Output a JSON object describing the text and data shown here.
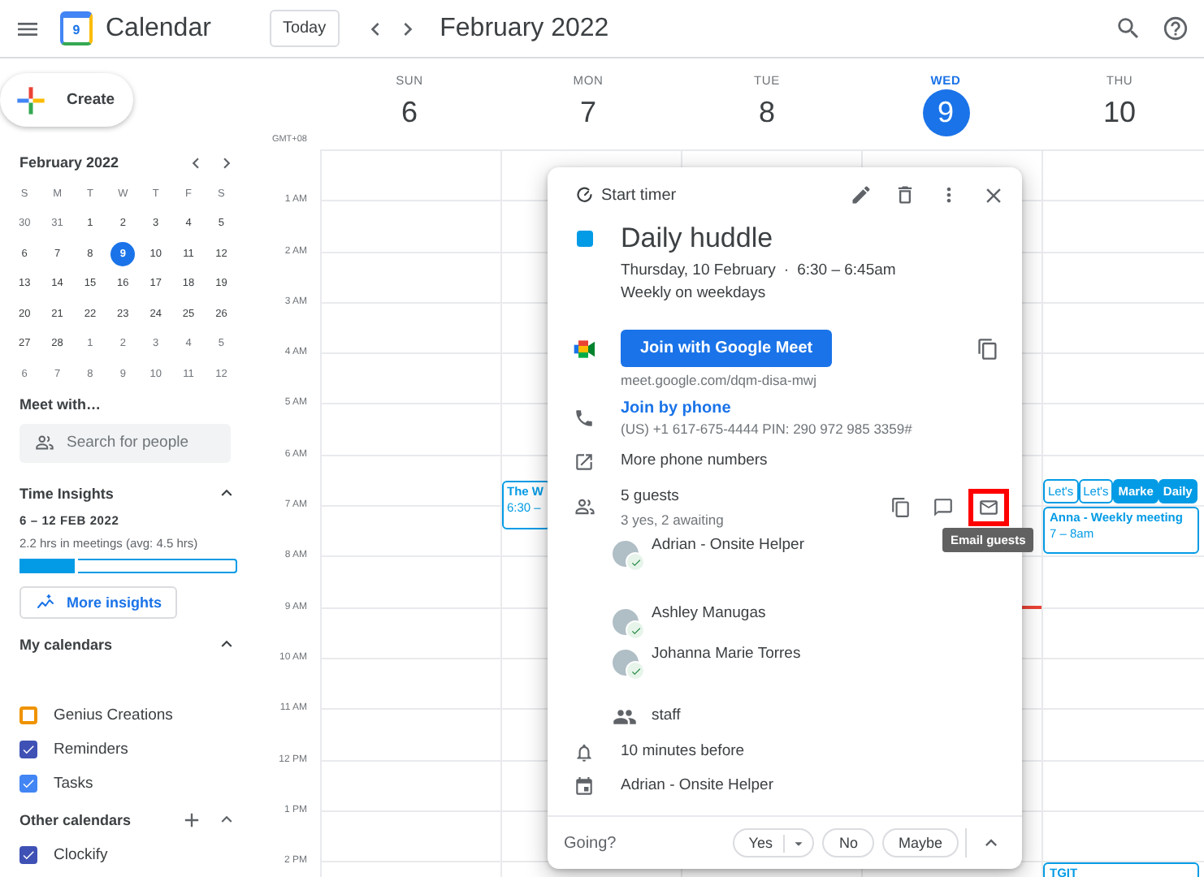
{
  "header": {
    "logo_day": "9",
    "app_name": "Calendar",
    "today_button": "Today",
    "period": "February 2022"
  },
  "sidebar": {
    "create_button": "Create",
    "mini_calendar": {
      "title": "February 2022",
      "weekdays": [
        "S",
        "M",
        "T",
        "W",
        "T",
        "F",
        "S"
      ],
      "weeks": [
        [
          {
            "day": "30",
            "outside": true,
            "selected": false
          },
          {
            "day": "31",
            "outside": true,
            "selected": false
          },
          {
            "day": "1",
            "outside": false,
            "selected": false
          },
          {
            "day": "2",
            "outside": false,
            "selected": false
          },
          {
            "day": "3",
            "outside": false,
            "selected": false
          },
          {
            "day": "4",
            "outside": false,
            "selected": false
          },
          {
            "day": "5",
            "outside": false,
            "selected": false
          }
        ],
        [
          {
            "day": "6",
            "outside": false,
            "selected": false
          },
          {
            "day": "7",
            "outside": false,
            "selected": false
          },
          {
            "day": "8",
            "outside": false,
            "selected": false
          },
          {
            "day": "9",
            "outside": false,
            "selected": true
          },
          {
            "day": "10",
            "outside": false,
            "selected": false
          },
          {
            "day": "11",
            "outside": false,
            "selected": false
          },
          {
            "day": "12",
            "outside": false,
            "selected": false
          }
        ],
        [
          {
            "day": "13",
            "outside": false,
            "selected": false
          },
          {
            "day": "14",
            "outside": false,
            "selected": false
          },
          {
            "day": "15",
            "outside": false,
            "selected": false
          },
          {
            "day": "16",
            "outside": false,
            "selected": false
          },
          {
            "day": "17",
            "outside": false,
            "selected": false
          },
          {
            "day": "18",
            "outside": false,
            "selected": false
          },
          {
            "day": "19",
            "outside": false,
            "selected": false
          }
        ],
        [
          {
            "day": "20",
            "outside": false,
            "selected": false
          },
          {
            "day": "21",
            "outside": false,
            "selected": false
          },
          {
            "day": "22",
            "outside": false,
            "selected": false
          },
          {
            "day": "23",
            "outside": false,
            "selected": false
          },
          {
            "day": "24",
            "outside": false,
            "selected": false
          },
          {
            "day": "25",
            "outside": false,
            "selected": false
          },
          {
            "day": "26",
            "outside": false,
            "selected": false
          }
        ],
        [
          {
            "day": "27",
            "outside": false,
            "selected": false
          },
          {
            "day": "28",
            "outside": false,
            "selected": false
          },
          {
            "day": "1",
            "outside": true,
            "selected": false
          },
          {
            "day": "2",
            "outside": true,
            "selected": false
          },
          {
            "day": "3",
            "outside": true,
            "selected": false
          },
          {
            "day": "4",
            "outside": true,
            "selected": false
          },
          {
            "day": "5",
            "outside": true,
            "selected": false
          }
        ],
        [
          {
            "day": "6",
            "outside": true,
            "selected": false
          },
          {
            "day": "7",
            "outside": true,
            "selected": false
          },
          {
            "day": "8",
            "outside": true,
            "selected": false
          },
          {
            "day": "9",
            "outside": true,
            "selected": false
          },
          {
            "day": "10",
            "outside": true,
            "selected": false
          },
          {
            "day": "11",
            "outside": true,
            "selected": false
          },
          {
            "day": "12",
            "outside": true,
            "selected": false
          }
        ]
      ]
    },
    "meet_with": {
      "title": "Meet with…",
      "search_placeholder": "Search for people"
    },
    "time_insights": {
      "title": "Time Insights",
      "expanded": true,
      "range": "6 – 12 FEB 2022",
      "summary": "2.2 hrs in meetings (avg: 4.5 hrs)",
      "level": 0.26,
      "button": "More insights"
    },
    "my_calendars": {
      "title": "My calendars",
      "expanded": true,
      "items": [
        {
          "name": "Genius Creations",
          "checked": false,
          "color": "#f09300"
        },
        {
          "name": "Reminders",
          "checked": true,
          "color": "#3f51b5"
        },
        {
          "name": "Tasks",
          "checked": true,
          "color": "#4285f4"
        }
      ]
    },
    "other_calendars": {
      "title": "Other calendars",
      "expanded": true,
      "items": [
        {
          "name": "Clockify",
          "checked": true,
          "color": "#3f51b5"
        }
      ]
    }
  },
  "grid": {
    "timezone": "GMT+08",
    "days": [
      {
        "weekday": "SUN",
        "date": "6",
        "selected": false
      },
      {
        "weekday": "MON",
        "date": "7",
        "selected": false
      },
      {
        "weekday": "TUE",
        "date": "8",
        "selected": false
      },
      {
        "weekday": "WED",
        "date": "9",
        "selected": true
      },
      {
        "weekday": "THU",
        "date": "10",
        "selected": false
      }
    ],
    "hours": [
      "1 AM",
      "2 AM",
      "3 AM",
      "4 AM",
      "5 AM",
      "6 AM",
      "7 AM",
      "8 AM",
      "9 AM",
      "10 AM",
      "11 AM",
      "12 PM",
      "1 PM",
      "2 PM"
    ],
    "events": [
      {
        "kind": "block",
        "overlapped": true,
        "title": "The W",
        "time": "6:30 –"
      },
      {
        "kind": "chips",
        "chips": [
          {
            "title": "Let's",
            "filled": false
          },
          {
            "title": "Let's",
            "filled": false
          },
          {
            "title": "Marke",
            "filled": true
          },
          {
            "title": "Daily",
            "filled": true
          }
        ]
      },
      {
        "kind": "block",
        "overlapped": false,
        "title": "Anna - Weekly meeting",
        "time": "7 – 8am"
      },
      {
        "kind": "block",
        "overlapped": false,
        "title": "TGIT"
      }
    ]
  },
  "event_popup": {
    "timer": "Start timer",
    "title": "Daily huddle",
    "color": "#039be5",
    "date": "Thursday, 10 February",
    "separator": "·",
    "time": "6:30 – 6:45am",
    "recurrence": "Weekly on weekdays",
    "meet_button": "Join with Google Meet",
    "meet_link": "meet.google.com/dqm-disa-mwj",
    "phone_link": "Join by phone",
    "phone_details": "(US) +1 617-675-4444 PIN: 290 972 985 3359#",
    "more_numbers": "More phone numbers",
    "guests": {
      "summary": "5 guests",
      "status": "3 yes, 2 awaiting",
      "tooltip": "Email guests",
      "actions": [
        {
          "kind": "copy",
          "highlighted": false
        },
        {
          "kind": "message",
          "highlighted": false
        },
        {
          "kind": "email",
          "highlighted": true
        }
      ],
      "list": [
        {
          "kind": "person",
          "name": "Adrian - Onsite Helper",
          "accepted": true
        },
        {
          "kind": "person",
          "name": "Ashley Manugas",
          "accepted": true
        },
        {
          "kind": "person",
          "name": "Johanna Marie Torres",
          "accepted": true
        },
        {
          "kind": "group",
          "name": "staff"
        }
      ]
    },
    "reminder": "10 minutes before",
    "organizer": "Adrian - Onsite Helper",
    "rsvp": {
      "prompt": "Going?",
      "options": [
        {
          "label": "Yes",
          "selected": false,
          "dropdown": true
        },
        {
          "label": "No",
          "selected": false,
          "dropdown": false
        },
        {
          "label": "Maybe",
          "selected": false,
          "dropdown": false
        }
      ]
    }
  }
}
